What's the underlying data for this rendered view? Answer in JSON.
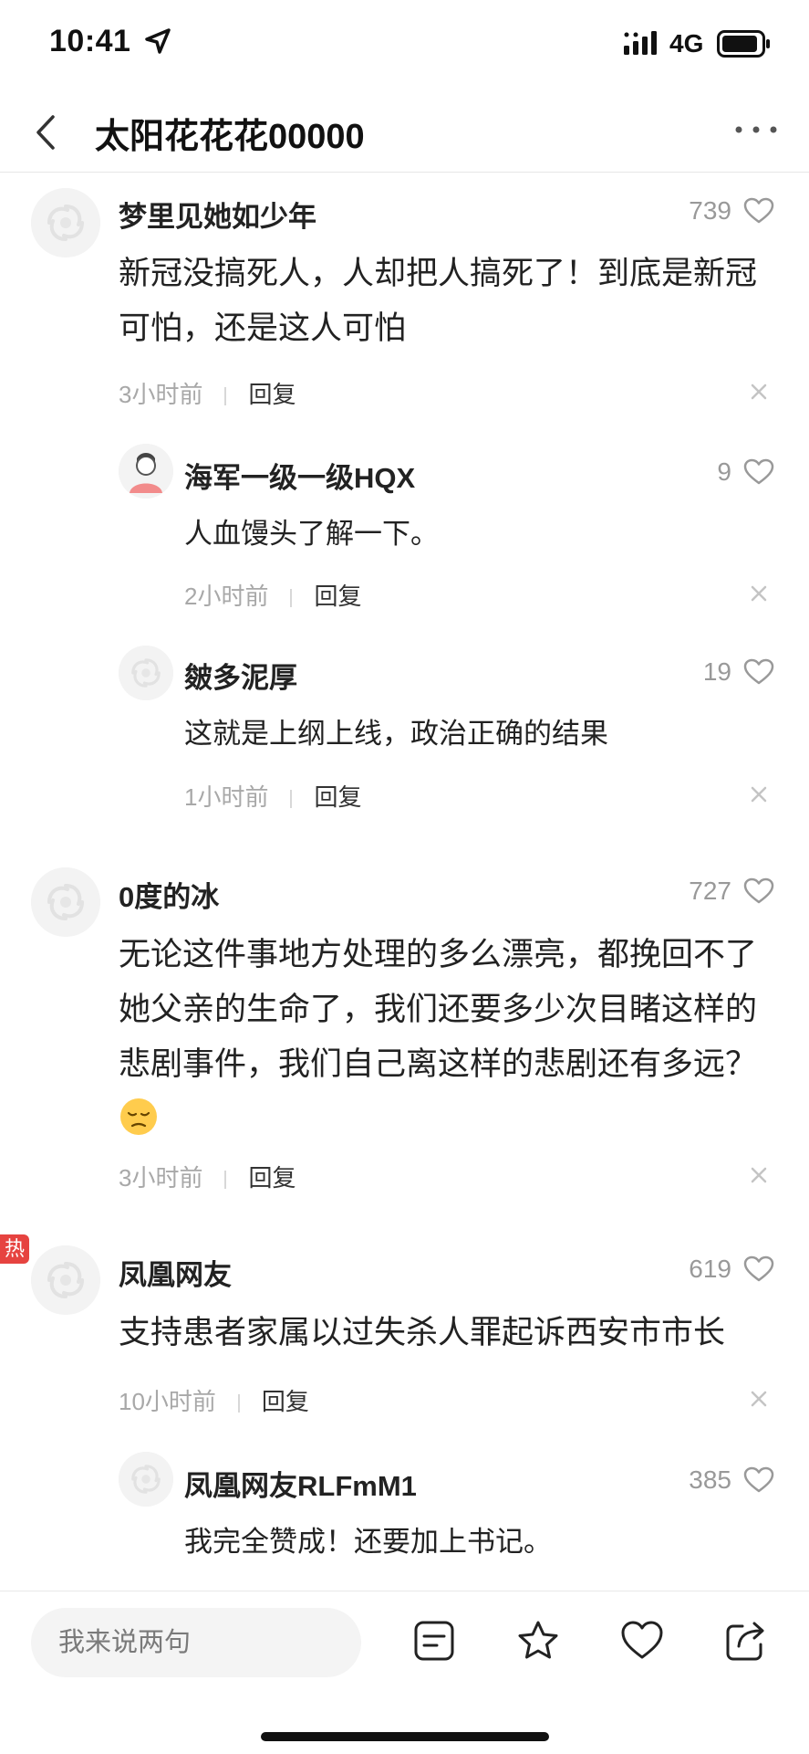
{
  "status": {
    "time": "10:41",
    "network": "4G"
  },
  "nav": {
    "title": "太阳花花花00000"
  },
  "comments": [
    {
      "user": "梦里见她如少年",
      "likes": "739",
      "text": "新冠没搞死人，人却把人搞死了！到底是新冠可怕，还是这人可怕",
      "time": "3小时前",
      "reply": "回复",
      "replies": [
        {
          "user": "海军一级一级HQX",
          "likes": "9",
          "text": "人血馒头了解一下。",
          "time": "2小时前",
          "reply": "回复"
        },
        {
          "user": "皴多泥厚",
          "likes": "19",
          "text": "这就是上纲上线，政治正确的结果",
          "time": "1小时前",
          "reply": "回复"
        }
      ]
    },
    {
      "user": "0度的冰",
      "likes": "727",
      "text": "无论这件事地方处理的多么漂亮，都挽回不了她父亲的生命了，我们还要多少次目睹这样的悲剧事件，我们自己离这样的悲剧还有多远？",
      "time": "3小时前",
      "reply": "回复"
    },
    {
      "user": "凤凰网友",
      "likes": "619",
      "hot_badge": "热",
      "text": "支持患者家属以过失杀人罪起诉西安市市长",
      "time": "10小时前",
      "reply": "回复",
      "replies": [
        {
          "user": "凤凰网友RLFmM1",
          "likes": "385",
          "text": "我完全赞成！还要加上书记。"
        }
      ]
    }
  ],
  "bottom_bar": {
    "input_placeholder": "我来说两句",
    "icons": [
      "comment-list-icon",
      "star-icon",
      "heart-icon",
      "share-icon"
    ]
  }
}
